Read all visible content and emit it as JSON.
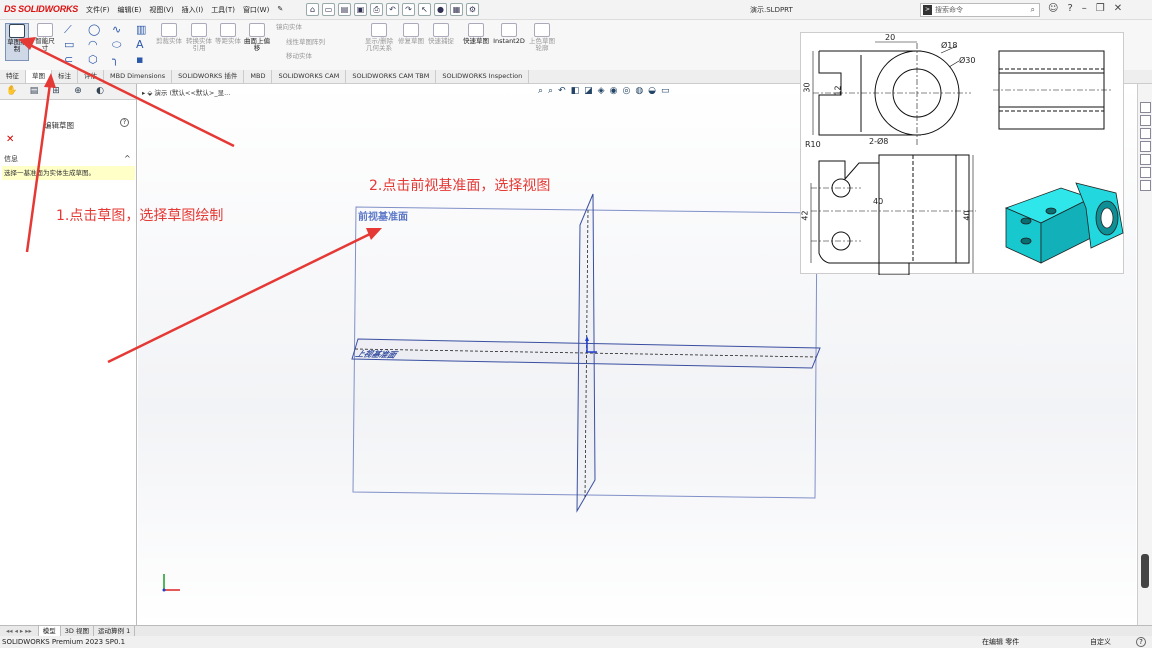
{
  "app": {
    "brand": "SOLIDWORKS",
    "document_title": "演示.SLDPRT",
    "command_search_placeholder": "搜索命令"
  },
  "menu": [
    "文件(F)",
    "编辑(E)",
    "视图(V)",
    "插入(I)",
    "工具(T)",
    "窗口(W)"
  ],
  "ribbon": {
    "sketch_label": "草图绘制",
    "smart_dim_label": "智能尺寸",
    "buttons": [
      {
        "label": "剪裁实体"
      },
      {
        "label": "转换实体引用"
      },
      {
        "label": "等距实体"
      },
      {
        "label": "曲面上偏移"
      },
      {
        "label": "镜向实体"
      },
      {
        "label": "线性草图阵列"
      },
      {
        "label": "移动实体"
      },
      {
        "label": "显示/删除几何关系"
      },
      {
        "label": "修复草图"
      },
      {
        "label": "快速捕捉"
      },
      {
        "label": "快速草图"
      },
      {
        "label": "Instant2D"
      },
      {
        "label": "上色草图轮廓"
      }
    ]
  },
  "tabs": [
    "特征",
    "草图",
    "标注",
    "评估",
    "MBD Dimensions",
    "SOLIDWORKS 插件",
    "MBD",
    "SOLIDWORKS CAM",
    "SOLIDWORKS CAM TBM",
    "SOLIDWORKS Inspection"
  ],
  "active_tab": "草图",
  "left_panel": {
    "title": "编辑草图",
    "message_header": "信息",
    "message": "选择一基准面为实体生成草图。"
  },
  "breadcrumb": "演示 (默认<<默认>_显...",
  "viewport": {
    "front_plane_label": "前视基准面",
    "top_plane_label": "上视基准面"
  },
  "annotations": {
    "step1": "1.点击草图，选择草图绘制",
    "step2": "2.点击前视基准面，选择视图",
    "color": "#e53935"
  },
  "reference_drawing": {
    "dims": [
      "20",
      "Ø18",
      "Ø30",
      "30",
      "12",
      "R10",
      "2-Ø8",
      "40",
      "42",
      "40"
    ],
    "model_color": "#1fe0e6"
  },
  "model_tabs": [
    "模型",
    "3D 视图",
    "运动算例 1"
  ],
  "status": {
    "version": "SOLIDWORKS Premium 2023 SP0.1",
    "editing": "在编辑 零件",
    "custom": "自定义"
  }
}
